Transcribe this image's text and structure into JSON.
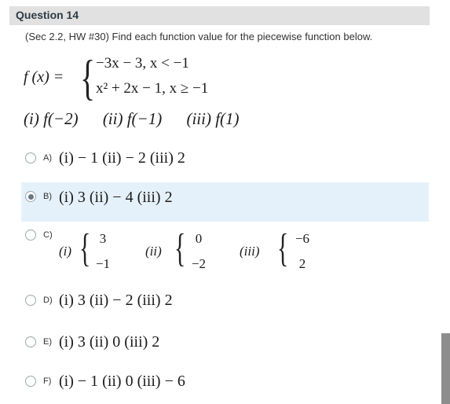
{
  "question": {
    "title": "Question 14",
    "prompt": "(Sec 2.2, HW #30) Find each function value for the piecewise function below."
  },
  "function": {
    "lhs": "f (x) =",
    "piece1": "−3x − 3,  x < −1",
    "piece2": "x² + 2x − 1,  x ≥ −1"
  },
  "parts": {
    "p1": "(i) f(−2)",
    "p2": "(ii) f(−1)",
    "p3": "(iii) f(1)"
  },
  "options": [
    {
      "label": "A)",
      "text": "(i)  − 1   (ii)  − 2   (iii) 2",
      "selected": false
    },
    {
      "label": "B)",
      "text": "(i) 3   (ii)  − 4   (iii) 2",
      "selected": true
    },
    {
      "label": "C)",
      "parts": [
        {
          "name": "(i)",
          "top": "3",
          "bottom": "−1"
        },
        {
          "name": "(ii)",
          "top": "0",
          "bottom": "−2"
        },
        {
          "name": "(iii)",
          "top": "−6",
          "bottom": "2"
        }
      ],
      "selected": false
    },
    {
      "label": "D)",
      "text": "(i) 3   (ii)  − 2   (iii) 2",
      "selected": false
    },
    {
      "label": "E)",
      "text": "(i) 3   (ii) 0   (iii) 2",
      "selected": false
    },
    {
      "label": "F)",
      "text": "(i)  − 1   (ii) 0   (iii)  − 6",
      "selected": false
    }
  ]
}
